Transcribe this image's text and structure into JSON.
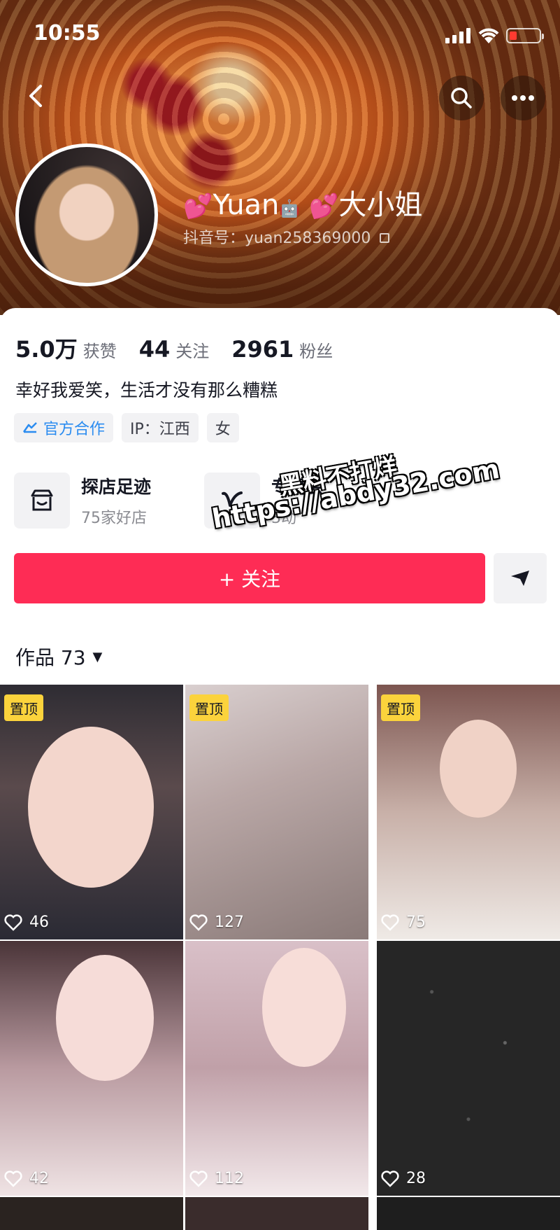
{
  "status_bar": {
    "time": "10:55"
  },
  "profile": {
    "name": "Yuan🤖 大小姐",
    "name_parts": {
      "prefix_emoji": "💕",
      "name": "Yuan",
      "suffix_emoji": "💕",
      "title": "大小姐"
    },
    "douyin_id": "抖音号：yuan258369000",
    "stats": [
      {
        "num": "5.0万",
        "label": "获赞"
      },
      {
        "num": "44",
        "label": "关注"
      },
      {
        "num": "2961",
        "label": "粉丝"
      }
    ],
    "bio": "幸好我爱笑，生活才没有那么糟糕",
    "tags": {
      "official": "官方合作",
      "ip": "IP：江西",
      "gender": "女"
    },
    "features": [
      {
        "title": "探店足迹",
        "sub": "75家好店",
        "icon": "store-icon"
      },
      {
        "title": "专属会",
        "sub": "3动",
        "icon": "vip-v-icon"
      }
    ],
    "follow_label": "+ 关注",
    "works_label": "作品 73"
  },
  "watermark": {
    "line1": "黑料不打烊",
    "line2": "https://abdy32.com"
  },
  "grid": {
    "pin_label": "置顶",
    "items": [
      {
        "likes": "46",
        "pinned": true
      },
      {
        "likes": "127",
        "pinned": true
      },
      {
        "likes": "75",
        "pinned": true
      },
      {
        "likes": "42",
        "pinned": false
      },
      {
        "likes": "112",
        "pinned": false
      },
      {
        "likes": "28",
        "pinned": false
      }
    ]
  },
  "colors": {
    "accent": "#fe2c55",
    "pin_badge": "#fbd33c",
    "official_blue": "#2b8cf0"
  }
}
